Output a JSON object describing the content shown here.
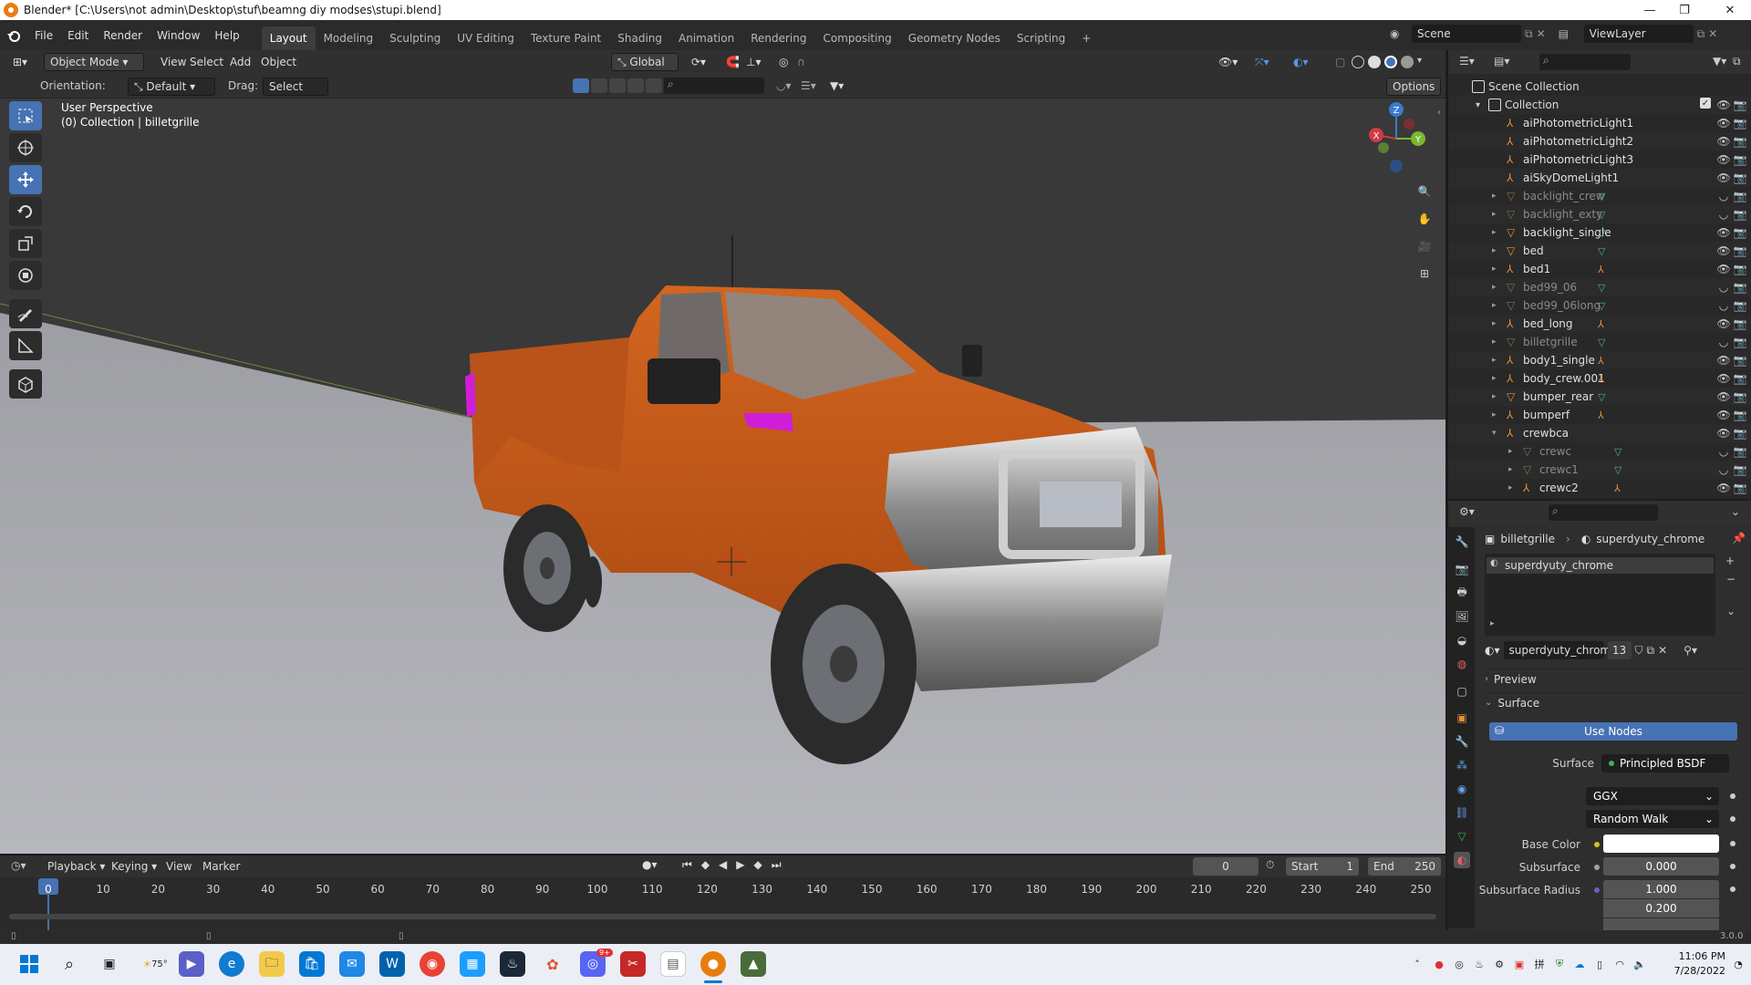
{
  "window": {
    "title": "Blender* [C:\\Users\\not admin\\Desktop\\stuf\\beamng diy modses\\stupi.blend]",
    "minimize": "—",
    "maximize": "❐",
    "close": "✕"
  },
  "menubar": {
    "menus": [
      "File",
      "Edit",
      "Render",
      "Window",
      "Help"
    ],
    "workspaces": [
      "Layout",
      "Modeling",
      "Sculpting",
      "UV Editing",
      "Texture Paint",
      "Shading",
      "Animation",
      "Rendering",
      "Compositing",
      "Geometry Nodes",
      "Scripting"
    ],
    "active_workspace": "Layout",
    "add_workspace": "+",
    "scene": "Scene",
    "view_layer": "ViewLayer"
  },
  "viewport_header": {
    "mode": "Object Mode",
    "menus": [
      "View",
      "Select",
      "Add",
      "Object"
    ],
    "transform_orientation": "Global",
    "orientation_label": "Orientation:",
    "orientation_value": "Default",
    "drag_label": "Drag:",
    "drag_value": "Select Box",
    "options": "Options"
  },
  "viewport": {
    "perspective": "User Perspective",
    "collection_info": "(0) Collection | billetgrille",
    "gizmo": {
      "x": "X",
      "y": "Y",
      "z": "Z"
    },
    "colors": {
      "floor": "#b3b4b9",
      "sky": "#393939",
      "truck_body": "#c0561a",
      "highlight": "#d01ed8",
      "x_axis": "#d03a49",
      "y_axis": "#7ab72f",
      "z_axis": "#3a7bd0"
    }
  },
  "tools": [
    "select-box",
    "cursor",
    "move",
    "rotate",
    "scale",
    "transform",
    "annotate",
    "measure",
    "add-cube"
  ],
  "outliner": {
    "search_placeholder": "",
    "root": "Scene Collection",
    "collection": "Collection",
    "items": [
      {
        "name": "aiPhotometricLight1",
        "type": "light",
        "expand": false,
        "dim": false,
        "extra": ""
      },
      {
        "name": "aiPhotometricLight2",
        "type": "light",
        "expand": false,
        "dim": false,
        "extra": ""
      },
      {
        "name": "aiPhotometricLight3",
        "type": "light",
        "expand": false,
        "dim": false,
        "extra": ""
      },
      {
        "name": "aiSkyDomeLight1",
        "type": "light",
        "expand": false,
        "dim": false,
        "extra": ""
      },
      {
        "name": "backlight_crew",
        "type": "mesh",
        "expand": true,
        "dim": true,
        "extra": "mesh"
      },
      {
        "name": "backlight_exty",
        "type": "mesh",
        "expand": true,
        "dim": true,
        "extra": "mesh"
      },
      {
        "name": "backlight_single",
        "type": "mesh",
        "expand": true,
        "dim": false,
        "extra": "mesh"
      },
      {
        "name": "bed",
        "type": "mesh",
        "expand": true,
        "dim": false,
        "extra": "mesh"
      },
      {
        "name": "bed1",
        "type": "empty",
        "expand": true,
        "dim": false,
        "extra": "empty"
      },
      {
        "name": "bed99_06",
        "type": "mesh",
        "expand": true,
        "dim": true,
        "extra": "mesh"
      },
      {
        "name": "bed99_06long",
        "type": "mesh",
        "expand": true,
        "dim": true,
        "extra": "mesh"
      },
      {
        "name": "bed_long",
        "type": "empty",
        "expand": true,
        "dim": false,
        "extra": "empty+mesh4"
      },
      {
        "name": "billetgrille",
        "type": "mesh",
        "expand": true,
        "dim": true,
        "extra": "mesh"
      },
      {
        "name": "body1_single",
        "type": "empty",
        "expand": true,
        "dim": false,
        "extra": "empty5"
      },
      {
        "name": "body_crew.001",
        "type": "empty",
        "expand": true,
        "dim": false,
        "extra": "empty13"
      },
      {
        "name": "bumper_rear",
        "type": "mesh",
        "expand": true,
        "dim": false,
        "extra": "mesh"
      },
      {
        "name": "bumperf",
        "type": "empty",
        "expand": true,
        "dim": false,
        "extra": "empty+mesh2"
      },
      {
        "name": "crewbca",
        "type": "empty",
        "expand": "open",
        "dim": false,
        "extra": ""
      },
      {
        "name": "crewc",
        "type": "mesh",
        "expand": true,
        "dim": true,
        "extra": "mesh",
        "indent": true
      },
      {
        "name": "crewc1",
        "type": "mesh",
        "expand": true,
        "dim": true,
        "extra": "mesh",
        "indent": true
      },
      {
        "name": "crewc2",
        "type": "empty",
        "expand": true,
        "dim": false,
        "extra": "empty",
        "indent": true
      }
    ]
  },
  "properties": {
    "breadcrumb_object": "billetgrille",
    "breadcrumb_material": "superdyuty_chrome",
    "slot": "superdyuty_chrome",
    "material_name": "superdyuty_chrome",
    "users": "13",
    "preview_panel": "Preview",
    "surface_panel": "Surface",
    "use_nodes": "Use Nodes",
    "surface_label": "Surface",
    "surface_value": "Principled BSDF",
    "distribution": "GGX",
    "subsurface_method": "Random Walk",
    "base_color_label": "Base Color",
    "subsurface_label": "Subsurface",
    "subsurface_value": "0.000",
    "subsurface_radius_label": "Subsurface Radius",
    "subsurface_radius": [
      "1.000",
      "0.200"
    ]
  },
  "timeline": {
    "menus": [
      "Playback",
      "Keying",
      "View",
      "Marker"
    ],
    "current_frame": "0",
    "start_label": "Start",
    "start": "1",
    "end_label": "End",
    "end": "250",
    "ticks": [
      "0",
      "10",
      "20",
      "30",
      "40",
      "50",
      "60",
      "70",
      "80",
      "90",
      "100",
      "110",
      "120",
      "130",
      "140",
      "150",
      "160",
      "170",
      "180",
      "190",
      "200",
      "210",
      "220",
      "230",
      "240",
      "250"
    ]
  },
  "statusbar": {
    "version": "3.0.0"
  },
  "taskbar": {
    "weather": "75°",
    "discord_badge": "9+",
    "time": "11:06 PM",
    "date": "7/28/2022"
  }
}
